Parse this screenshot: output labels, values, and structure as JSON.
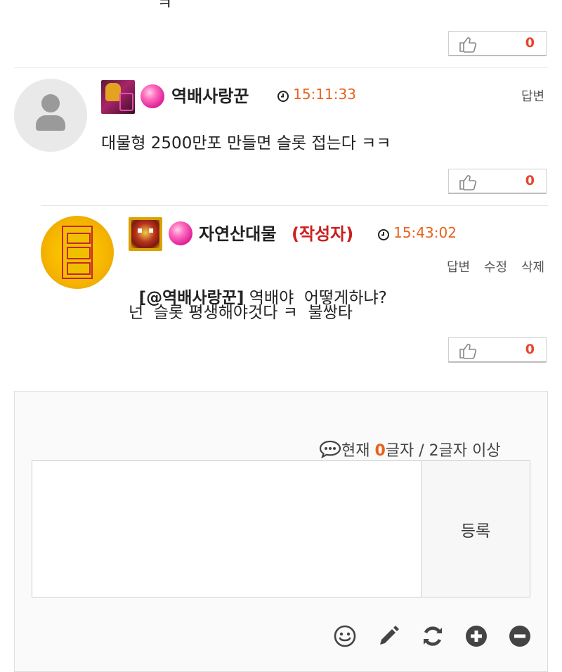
{
  "top_comment": {
    "text_tail": "ㅋ",
    "likes": "0"
  },
  "comment1": {
    "nickname": "역배사랑꾼",
    "time": "15:11:33",
    "reply_label": "답변",
    "text": "대물형 2500만포 만들면 슬롯 접는다 ㅋㅋ",
    "likes": "0"
  },
  "comment2": {
    "nickname": "자연산대물",
    "author_tag": "(작성자)",
    "time": "15:43:02",
    "reply_label": "답변",
    "edit_label": "수정",
    "delete_label": "삭제",
    "mention": "[@역배사랑꾼]",
    "line1": " 역배야  어떻게하냐?",
    "line2": "넌  슬롯 평생해야것다 ㅋ  불쌍타",
    "likes": "0"
  },
  "write_box": {
    "counter_prefix": "현재 ",
    "counter_value": "0",
    "counter_suffix": "글자 / 2글자 이상",
    "textarea_value": "",
    "submit_label": "등록"
  },
  "toolbar": {
    "icons": [
      "smile-icon",
      "pencil-icon",
      "refresh-icon",
      "plus-circle-icon",
      "minus-circle-icon"
    ]
  },
  "colors": {
    "accent_orange": "#e8621b",
    "author_red": "#cc1f1f",
    "like_count": "#e8452f",
    "icon_gray": "#444444"
  }
}
